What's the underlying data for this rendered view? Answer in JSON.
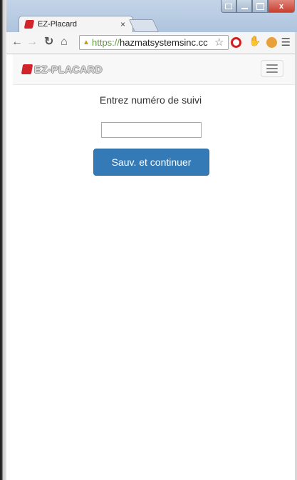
{
  "browser": {
    "tab_title": "EZ-Placard",
    "tab_close": "×",
    "url_scheme": "https://",
    "url_host": "hazmatsystemsinc.cc",
    "window_close": "x"
  },
  "navbar": {
    "brand": "EZ-PLACARD"
  },
  "form": {
    "prompt": "Entrez numéro de suivi",
    "input_value": "",
    "submit_label": "Sauv. et continuer"
  },
  "colors": {
    "primary_button": "#337ab7",
    "brand_red": "#d0232a"
  }
}
